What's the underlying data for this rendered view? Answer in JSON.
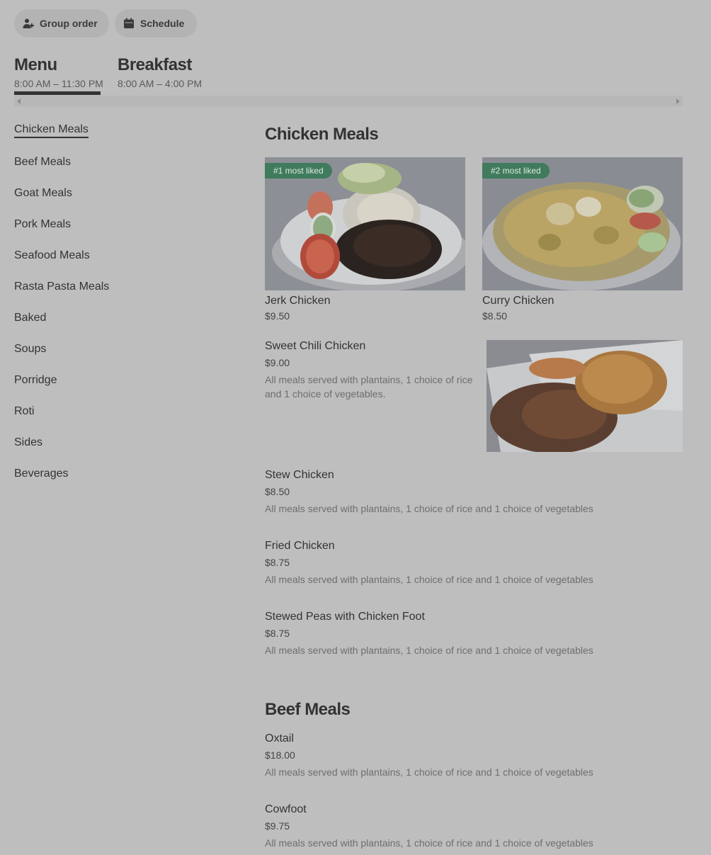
{
  "header": {
    "group_order": "Group order",
    "schedule": "Schedule"
  },
  "menus": [
    {
      "title": "Menu",
      "hours": "8:00 AM – 11:30 PM"
    },
    {
      "title": "Breakfast",
      "hours": "8:00 AM – 4:00 PM"
    }
  ],
  "sidebar": {
    "items": [
      {
        "label": "Chicken Meals"
      },
      {
        "label": "Beef Meals"
      },
      {
        "label": "Goat Meals"
      },
      {
        "label": "Pork Meals"
      },
      {
        "label": "Seafood Meals"
      },
      {
        "label": "Rasta Pasta Meals"
      },
      {
        "label": "Baked"
      },
      {
        "label": "Soups"
      },
      {
        "label": "Porridge"
      },
      {
        "label": "Roti"
      },
      {
        "label": "Sides"
      },
      {
        "label": "Beverages"
      }
    ]
  },
  "sections": [
    {
      "title": "Chicken Meals",
      "featured": [
        {
          "badge": "#1 most liked",
          "name": "Jerk Chicken",
          "price": "$9.50"
        },
        {
          "badge": "#2 most liked",
          "name": "Curry Chicken",
          "price": "$8.50"
        }
      ],
      "items": [
        {
          "name": "Sweet Chili Chicken",
          "price": "$9.00",
          "desc": "All meals served with plantains, 1 choice of rice and 1 choice of vegetables."
        },
        {
          "name": "Stew Chicken",
          "price": "$8.50",
          "desc": "All meals served with plantains, 1 choice of rice and 1 choice of vegetables"
        },
        {
          "name": "Fried Chicken",
          "price": "$8.75",
          "desc": "All meals served with plantains, 1 choice of rice and 1 choice of vegetables"
        },
        {
          "name": "Stewed Peas with Chicken Foot",
          "price": "$8.75",
          "desc": "All meals served with plantains, 1 choice of rice and 1 choice of vegetables"
        }
      ]
    },
    {
      "title": "Beef Meals",
      "items": [
        {
          "name": "Oxtail",
          "price": "$18.00",
          "desc": "All meals served with plantains, 1 choice of rice and 1 choice of vegetables"
        },
        {
          "name": "Cowfoot",
          "price": "$9.75",
          "desc": "All meals served with plantains, 1 choice of rice and 1 choice of vegetables"
        }
      ]
    }
  ]
}
